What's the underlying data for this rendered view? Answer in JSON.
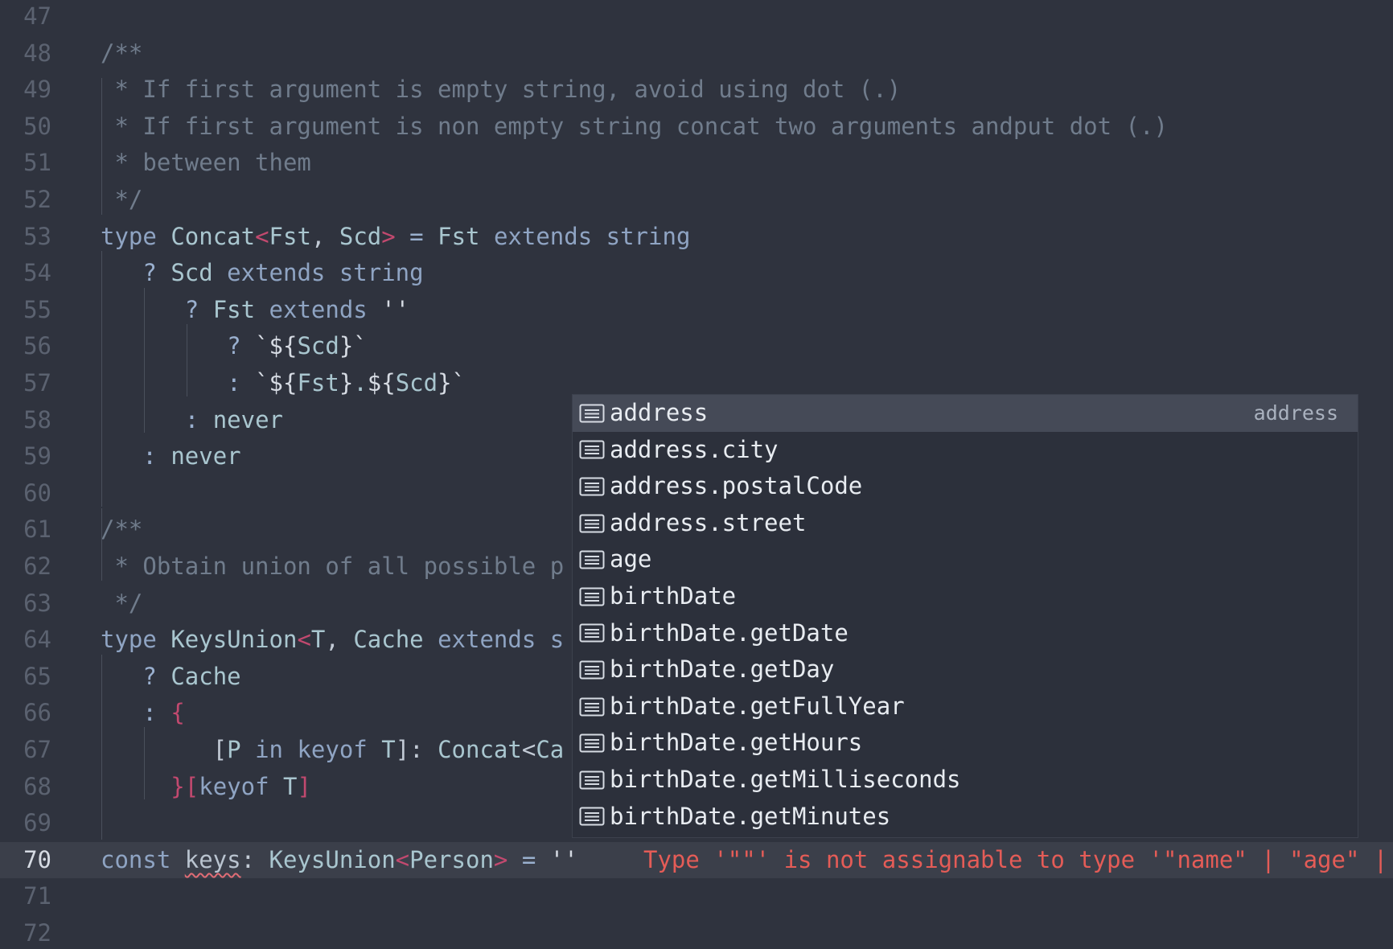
{
  "editor": {
    "lines": [
      {
        "n": "47",
        "tokens": []
      },
      {
        "n": "48",
        "tokens": [
          {
            "t": "/**",
            "c": "tok-comment"
          }
        ]
      },
      {
        "n": "49",
        "tokens": [
          {
            "t": " * If first argument is empty string, avoid using dot (.)",
            "c": "tok-comment"
          }
        ]
      },
      {
        "n": "50",
        "tokens": [
          {
            "t": " * If first argument is non empty string concat two arguments andput dot (.)",
            "c": "tok-comment"
          }
        ]
      },
      {
        "n": "51",
        "tokens": [
          {
            "t": " * between them",
            "c": "tok-comment"
          }
        ]
      },
      {
        "n": "52",
        "tokens": [
          {
            "t": " */",
            "c": "tok-comment"
          }
        ]
      },
      {
        "n": "53",
        "tokens": [
          {
            "t": "type ",
            "c": "tok-kw"
          },
          {
            "t": "Concat",
            "c": "tok-type"
          },
          {
            "t": "<",
            "c": "tok-angle"
          },
          {
            "t": "Fst",
            "c": "tok-type"
          },
          {
            "t": ", ",
            "c": "tok-punct"
          },
          {
            "t": "Scd",
            "c": "tok-type"
          },
          {
            "t": ">",
            "c": "tok-angle"
          },
          {
            "t": " = ",
            "c": "tok-op"
          },
          {
            "t": "Fst",
            "c": "tok-type"
          },
          {
            "t": " extends ",
            "c": "tok-kw"
          },
          {
            "t": "string",
            "c": "tok-kw"
          }
        ]
      },
      {
        "n": "54",
        "tokens": [
          {
            "t": "   ? ",
            "c": "tok-op"
          },
          {
            "t": "Scd",
            "c": "tok-type"
          },
          {
            "t": " extends ",
            "c": "tok-kw"
          },
          {
            "t": "string",
            "c": "tok-kw"
          }
        ]
      },
      {
        "n": "55",
        "tokens": [
          {
            "t": "      ? ",
            "c": "tok-op"
          },
          {
            "t": "Fst",
            "c": "tok-type"
          },
          {
            "t": " extends ",
            "c": "tok-kw"
          },
          {
            "t": "''",
            "c": "tok-str"
          }
        ]
      },
      {
        "n": "56",
        "tokens": [
          {
            "t": "         ? ",
            "c": "tok-op"
          },
          {
            "t": "`${",
            "c": "tok-str"
          },
          {
            "t": "Scd",
            "c": "tok-type"
          },
          {
            "t": "}`",
            "c": "tok-str"
          }
        ]
      },
      {
        "n": "57",
        "tokens": [
          {
            "t": "         : ",
            "c": "tok-op"
          },
          {
            "t": "`${",
            "c": "tok-str"
          },
          {
            "t": "Fst",
            "c": "tok-type"
          },
          {
            "t": "}",
            "c": "tok-str"
          },
          {
            "t": ".",
            "c": "tok-type"
          },
          {
            "t": "${",
            "c": "tok-str"
          },
          {
            "t": "Scd",
            "c": "tok-type"
          },
          {
            "t": "}`",
            "c": "tok-str"
          }
        ]
      },
      {
        "n": "58",
        "tokens": [
          {
            "t": "      : ",
            "c": "tok-op"
          },
          {
            "t": "never",
            "c": "tok-type"
          }
        ]
      },
      {
        "n": "59",
        "tokens": [
          {
            "t": "   : ",
            "c": "tok-op"
          },
          {
            "t": "never",
            "c": "tok-type"
          }
        ]
      },
      {
        "n": "60",
        "tokens": []
      },
      {
        "n": "61",
        "tokens": [
          {
            "t": "/**",
            "c": "tok-comment"
          }
        ]
      },
      {
        "n": "62",
        "tokens": [
          {
            "t": " * Obtain union of all possible p",
            "c": "tok-comment"
          }
        ]
      },
      {
        "n": "63",
        "tokens": [
          {
            "t": " */",
            "c": "tok-comment"
          }
        ]
      },
      {
        "n": "64",
        "tokens": [
          {
            "t": "type ",
            "c": "tok-kw"
          },
          {
            "t": "KeysUnion",
            "c": "tok-type"
          },
          {
            "t": "<",
            "c": "tok-angle"
          },
          {
            "t": "T",
            "c": "tok-type"
          },
          {
            "t": ", ",
            "c": "tok-punct"
          },
          {
            "t": "Cache",
            "c": "tok-type"
          },
          {
            "t": " extends ",
            "c": "tok-kw"
          },
          {
            "t": "s",
            "c": "tok-kw"
          }
        ]
      },
      {
        "n": "65",
        "tokens": [
          {
            "t": "   ? ",
            "c": "tok-op"
          },
          {
            "t": "Cache",
            "c": "tok-type"
          }
        ]
      },
      {
        "n": "66",
        "tokens": [
          {
            "t": "   : ",
            "c": "tok-op"
          },
          {
            "t": "{",
            "c": "tok-angle"
          }
        ]
      },
      {
        "n": "67",
        "tokens": [
          {
            "t": "        [",
            "c": "tok-punct"
          },
          {
            "t": "P",
            "c": "tok-type"
          },
          {
            "t": " in ",
            "c": "tok-kw"
          },
          {
            "t": "keyof ",
            "c": "tok-kw"
          },
          {
            "t": "T",
            "c": "tok-type"
          },
          {
            "t": "]: ",
            "c": "tok-punct"
          },
          {
            "t": "Concat",
            "c": "tok-type"
          },
          {
            "t": "<",
            "c": "tok-punct"
          },
          {
            "t": "Ca",
            "c": "tok-type"
          }
        ]
      },
      {
        "n": "68",
        "tokens": [
          {
            "t": "     }",
            "c": "tok-angle"
          },
          {
            "t": "[",
            "c": "tok-angle"
          },
          {
            "t": "keyof ",
            "c": "tok-kw"
          },
          {
            "t": "T",
            "c": "tok-type"
          },
          {
            "t": "]",
            "c": "tok-angle"
          }
        ]
      },
      {
        "n": "69",
        "tokens": []
      },
      {
        "n": "70",
        "current": true,
        "tokens": [
          {
            "t": "const ",
            "c": "tok-kw"
          },
          {
            "t": "keys",
            "c": "tok-var squiggle"
          },
          {
            "t": ": ",
            "c": "tok-punct"
          },
          {
            "t": "KeysUnion",
            "c": "tok-type"
          },
          {
            "t": "<",
            "c": "tok-angle"
          },
          {
            "t": "Person",
            "c": "tok-type"
          },
          {
            "t": ">",
            "c": "tok-angle"
          },
          {
            "t": " = ",
            "c": "tok-op"
          },
          {
            "t": "''",
            "c": "tok-str"
          }
        ],
        "error": "Type '\"\"' is not assignable to type '\"name\" | \"age\" |"
      },
      {
        "n": "71",
        "tokens": []
      },
      {
        "n": "72",
        "tokens": []
      }
    ]
  },
  "suggest": {
    "icon": "field-icon",
    "items": [
      {
        "label": "address",
        "detail": "address",
        "selected": true
      },
      {
        "label": "address.city"
      },
      {
        "label": "address.postalCode"
      },
      {
        "label": "address.street"
      },
      {
        "label": "age"
      },
      {
        "label": "birthDate"
      },
      {
        "label": "birthDate.getDate"
      },
      {
        "label": "birthDate.getDay"
      },
      {
        "label": "birthDate.getFullYear"
      },
      {
        "label": "birthDate.getHours"
      },
      {
        "label": "birthDate.getMilliseconds"
      },
      {
        "label": "birthDate.getMinutes"
      }
    ]
  }
}
